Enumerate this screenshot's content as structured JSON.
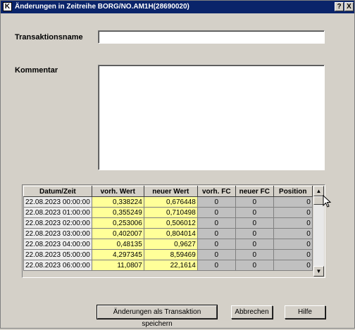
{
  "window": {
    "title": "Änderungen in Zeitreihe BORG/NO.AM1H(28690020)",
    "help_btn": "?",
    "close_btn": "X"
  },
  "form": {
    "transaction_label": "Transaktionsname",
    "transaction_value": "",
    "comment_label": "Kommentar",
    "comment_value": ""
  },
  "table": {
    "columns": [
      "Datum/Zeit",
      "vorh. Wert",
      "neuer Wert",
      "vorh. FC",
      "neuer FC",
      "Position"
    ],
    "rows": [
      [
        "22.08.2023 00:00:00",
        "0,338224",
        "0,676448",
        "0",
        "0",
        "0"
      ],
      [
        "22.08.2023 01:00:00",
        "0,355249",
        "0,710498",
        "0",
        "0",
        "0"
      ],
      [
        "22.08.2023 02:00:00",
        "0,253006",
        "0,506012",
        "0",
        "0",
        "0"
      ],
      [
        "22.08.2023 03:00:00",
        "0,402007",
        "0,804014",
        "0",
        "0",
        "0"
      ],
      [
        "22.08.2023 04:00:00",
        "0,48135",
        "0,9627",
        "0",
        "0",
        "0"
      ],
      [
        "22.08.2023 05:00:00",
        "4,297345",
        "8,59469",
        "0",
        "0",
        "0"
      ],
      [
        "22.08.2023 06:00:00",
        "11,0807",
        "22,1614",
        "0",
        "0",
        "0"
      ]
    ]
  },
  "buttons": {
    "save": "Änderungen als Transaktion speichern",
    "cancel": "Abbrechen",
    "help": "Hilfe"
  }
}
